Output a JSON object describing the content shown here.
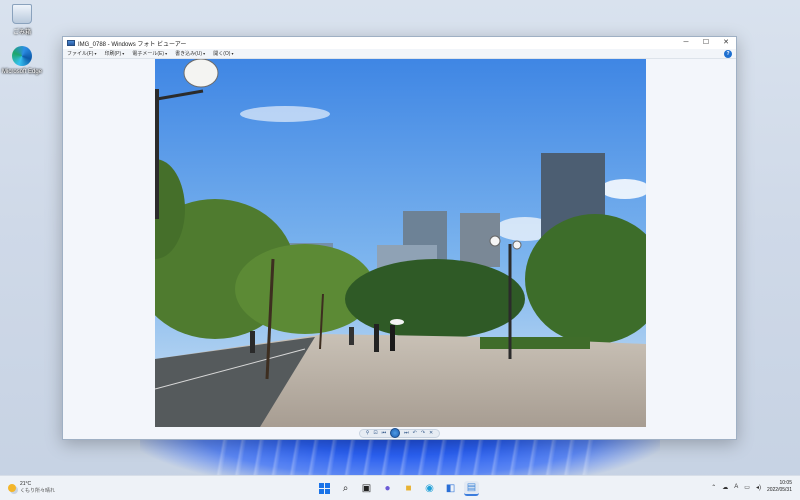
{
  "desktop": {
    "icons": [
      {
        "label": "ごみ箱",
        "icon": "recycle-bin-icon"
      },
      {
        "label": "Microsoft Edge",
        "icon": "edge-icon"
      }
    ]
  },
  "window": {
    "title": "IMG_0788 - Windows フォト ビューアー",
    "controls": {
      "minimize": "─",
      "maximize": "☐",
      "close": "✕"
    },
    "menu": [
      {
        "label": "ファイル(F)"
      },
      {
        "label": "印刷(P)"
      },
      {
        "label": "電子メール(E)"
      },
      {
        "label": "書き込み(U)"
      },
      {
        "label": "開く(O)"
      }
    ],
    "help_label": "?",
    "image_icon": "photo-city-park"
  },
  "viewer_controls": {
    "zoom": "⚲",
    "actual_size": "⊡",
    "previous": "⏮",
    "slideshow": "▶",
    "next": "⏭",
    "rotate_left": "↶",
    "rotate_right": "↷",
    "delete": "✕"
  },
  "taskbar": {
    "weather_temp": "21°C",
    "weather_desc": "くもり所々晴れ",
    "tray_input": "A",
    "clock_time": "10:05",
    "clock_date": "2022/05/31",
    "accent": "#1a73e8"
  }
}
